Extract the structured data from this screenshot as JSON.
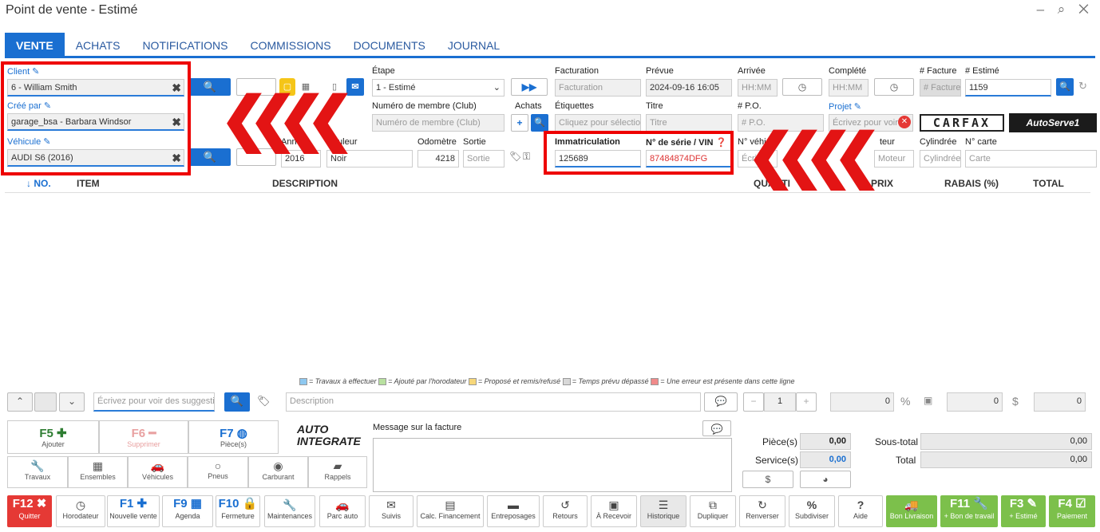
{
  "window": {
    "title": "Point de vente - Estimé",
    "controls": "– ⌕ ✕"
  },
  "tabs": [
    "VENTE",
    "ACHATS",
    "NOTIFICATIONS",
    "COMMISSIONS",
    "DOCUMENTS",
    "JOURNAL"
  ],
  "client": {
    "label": "Client",
    "value": "6 - William Smith"
  },
  "created_by": {
    "label": "Créé par",
    "value": "garage_bsa - Barbara Windsor"
  },
  "vehicle": {
    "label": "Véhicule",
    "value": "AUDI S6 (2016)"
  },
  "etape": {
    "label": "Étape",
    "value": "1 - Estimé"
  },
  "membre": {
    "label": "Numéro de membre (Club)",
    "placeholder": "Numéro de membre (Club)"
  },
  "achats": {
    "label": "Achats"
  },
  "etiquettes": {
    "label": "Étiquettes",
    "placeholder": "Cliquez pour sélection"
  },
  "facturation": {
    "label": "Facturation",
    "placeholder": "Facturation"
  },
  "prevue": {
    "label": "Prévue",
    "value": "2024-09-16 16:05"
  },
  "arrivee": {
    "label": "Arrivée",
    "placeholder": "HH:MM"
  },
  "complete": {
    "label": "Complété",
    "placeholder": "HH:MM"
  },
  "facture_no": {
    "label": "# Facture",
    "placeholder": "# Facture"
  },
  "estime_no": {
    "label": "# Estimé",
    "value": "1159"
  },
  "titre": {
    "label": "Titre",
    "placeholder": "Titre"
  },
  "po": {
    "label": "# P.O.",
    "placeholder": "# P.O."
  },
  "projet": {
    "label": "Projet",
    "placeholder": "Écrivez pour voir de"
  },
  "carfax": "CARFAX",
  "autoserve": "AutoServe1",
  "annee": {
    "label": "Année",
    "value": "2016"
  },
  "couleur": {
    "label": "Couleur",
    "value": "Noir"
  },
  "odometre": {
    "label": "Odomètre",
    "value": "4218"
  },
  "sortie": {
    "label": "Sortie",
    "placeholder": "Sortie"
  },
  "immatriculation": {
    "label": "Immatriculation",
    "value": "125689"
  },
  "vin": {
    "label": "N° de série / VIN",
    "value": "87484874DFG"
  },
  "no_vehicule": {
    "label": "N° véhi",
    "placeholder": "Écri"
  },
  "moteur": {
    "label": "teur",
    "placeholder": "Moteur"
  },
  "cylindree": {
    "label": "Cylindrée",
    "placeholder": "Cylindrée"
  },
  "carte": {
    "label": "N° carte",
    "placeholder": "Carte"
  },
  "table_headers": [
    "↓ NO.",
    "ITEM",
    "DESCRIPTION",
    "QUANTI",
    "PRIX",
    "RABAIS (%)",
    "TOTAL"
  ],
  "legend": [
    {
      "color": "#8ec8f0",
      "text": "= Travaux à effectuer"
    },
    {
      "color": "#b8e0a0",
      "text": "= Ajouté par l'horodateur"
    },
    {
      "color": "#f7d77a",
      "text": "= Proposé et remis/refusé"
    },
    {
      "color": "#d8d8d8",
      "text": "= Temps prévu dépassé"
    },
    {
      "color": "#f08a8a",
      "text": "= Une erreur est présente dans cette ligne"
    }
  ],
  "entry": {
    "search_placeholder": "Écrivez pour voir des suggestion",
    "desc_placeholder": "Description",
    "qty": "1",
    "price": "0",
    "discount": "0",
    "total": "0"
  },
  "fkeys": {
    "f5": "F5",
    "f5_label": "Ajouter",
    "f6": "F6",
    "f6_label": "Supprimer",
    "f7": "F7",
    "f7_label": "Pièce(s)"
  },
  "autointegrate": "AUTO INTEGRATE",
  "categories": [
    "Travaux",
    "Ensembles",
    "Véhicules",
    "Pneus",
    "Carburant",
    "Rappels"
  ],
  "message": {
    "label": "Message sur la facture"
  },
  "totals": {
    "pieces_label": "Pièce(s)",
    "pieces": "0,00",
    "service_label": "Service(s)",
    "service": "0,00",
    "soustotal_label": "Sous-total",
    "soustotal": "0,00",
    "total_label": "Total",
    "total": "0,00"
  },
  "bottom": [
    {
      "key": "F12",
      "label": "Quitter"
    },
    {
      "key": "",
      "label": "Horodateur"
    },
    {
      "key": "F1",
      "label": "Nouvelle vente"
    },
    {
      "key": "F9",
      "label": "Agenda"
    },
    {
      "key": "F10",
      "label": "Fermeture"
    },
    {
      "key": "",
      "label": "Maintenances"
    },
    {
      "key": "",
      "label": "Parc auto"
    },
    {
      "key": "",
      "label": "Suivis"
    },
    {
      "key": "",
      "label": "Calc. Financement"
    },
    {
      "key": "",
      "label": "Entreposages"
    },
    {
      "key": "",
      "label": "Retours"
    },
    {
      "key": "",
      "label": "À Recevoir"
    },
    {
      "key": "",
      "label": "Historique"
    },
    {
      "key": "",
      "label": "Dupliquer"
    },
    {
      "key": "",
      "label": "Renverser"
    },
    {
      "key": "",
      "label": "Subdiviser"
    },
    {
      "key": "",
      "label": "Aide"
    },
    {
      "key": "",
      "label": "Bon Livraison"
    },
    {
      "key": "F11",
      "label": "+ Bon de travail"
    },
    {
      "key": "F3",
      "label": "+ Estimé"
    },
    {
      "key": "F4",
      "label": "Paiement"
    }
  ]
}
